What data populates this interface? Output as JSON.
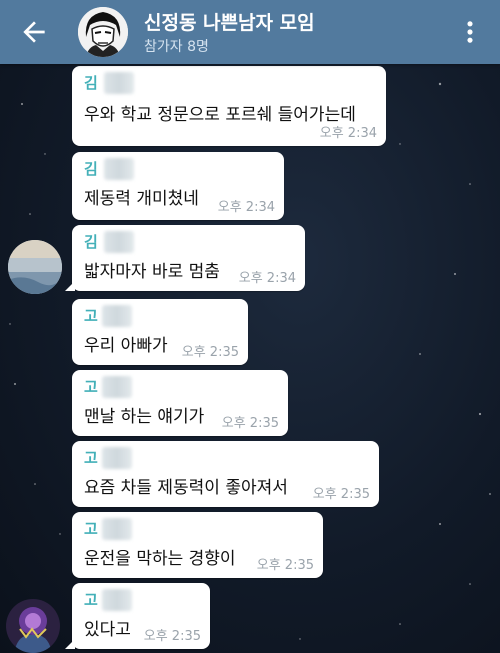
{
  "header": {
    "title": "신정동 나쁜남자 모임",
    "subtitle": "참가자 8명",
    "back_icon": "arrow-left-icon",
    "menu_icon": "more-vertical-icon",
    "bg_color": "#527a9e"
  },
  "messages": [
    {
      "sender": "김",
      "text": "우와 학교 정문으로 포르쉐 들어가는데",
      "time": "오후 2:34"
    },
    {
      "sender": "김",
      "text": "제동력 개미쳤네",
      "time": "오후 2:34"
    },
    {
      "sender": "김",
      "text": "밟자마자 바로 멈춤",
      "time": "오후 2:34"
    },
    {
      "sender": "고",
      "text": "우리 아빠가",
      "time": "오후 2:35"
    },
    {
      "sender": "고",
      "text": "맨날 하는 얘기가",
      "time": "오후 2:35"
    },
    {
      "sender": "고",
      "text": "요즘 차들 제동력이 좋아져서",
      "time": "오후 2:35"
    },
    {
      "sender": "고",
      "text": "운전을 막하는 경향이",
      "time": "오후 2:35"
    },
    {
      "sender": "고",
      "text": "있다고",
      "time": "오후 2:35"
    }
  ],
  "colors": {
    "sender_name": "#43b0b8",
    "bubble": "#ffffff",
    "timestamp": "#9aa3ab"
  }
}
